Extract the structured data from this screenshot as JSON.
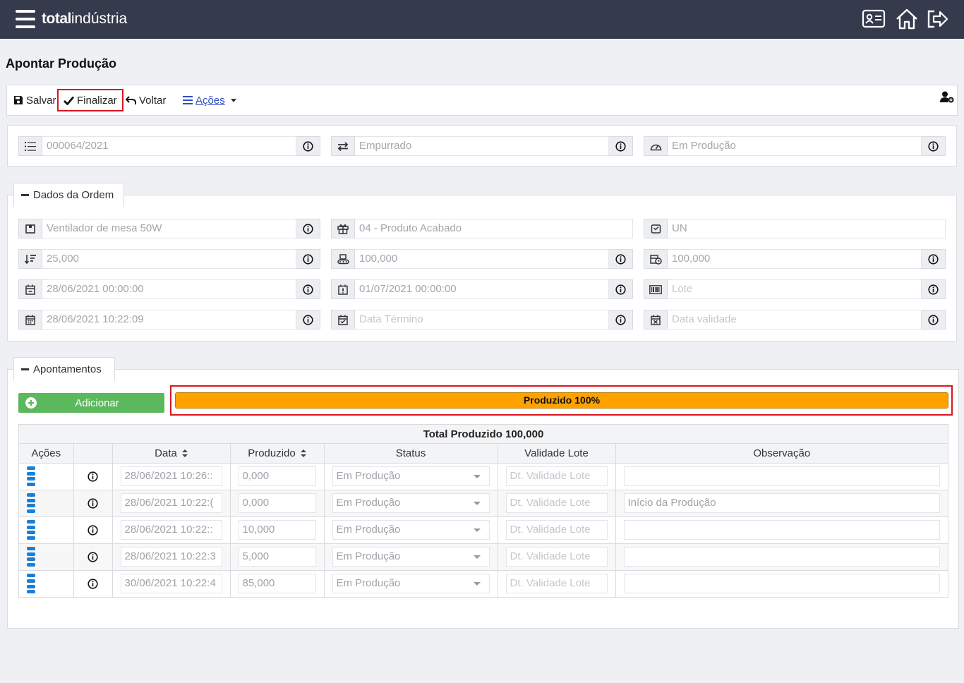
{
  "header": {
    "brand_bold": "total",
    "brand_light": "indústria"
  },
  "page_title": "Apontar Produção",
  "toolbar": {
    "save_label": "Salvar",
    "finalize_label": "Finalizar",
    "back_label": "Voltar",
    "actions_label": "Ações"
  },
  "top_fields": {
    "order_number": "000064/2021",
    "flow_type": "Empurrado",
    "status": "Em Produção"
  },
  "order_section": {
    "legend": "Dados da Ordem",
    "product": "Ventilador de mesa 50W",
    "product_type": "04 - Produto Acabado",
    "unit": "UN",
    "qty_1": "25,000",
    "qty_2": "100,000",
    "qty_3": "100,000",
    "date_1": "28/06/2021 00:00:00",
    "date_2": "01/07/2021 00:00:00",
    "lot_placeholder": "Lote",
    "start_date": "28/06/2021 10:22:09",
    "end_date_placeholder": "Data Término",
    "expiry_placeholder": "Data validade"
  },
  "appointments_section": {
    "legend": "Apontamentos",
    "add_button": "Adicionar",
    "progress_label": "Produzido 100%",
    "progress_value": 1.0,
    "total_label": "Total Produzido 100,000",
    "columns": [
      "Ações",
      "",
      "Data",
      "Produzido",
      "Status",
      "Validade Lote",
      "Observação"
    ],
    "rows": [
      {
        "date": "28/06/2021 10:26::",
        "produced": "0,000",
        "status": "Em Produção",
        "lot_expiry": "Dt. Validade Lote",
        "note": ""
      },
      {
        "date": "28/06/2021 10:22:(",
        "produced": "0,000",
        "status": "Em Produção",
        "lot_expiry": "Dt. Validade Lote",
        "note": "Início da Produção"
      },
      {
        "date": "28/06/2021 10:22::",
        "produced": "10,000",
        "status": "Em Produção",
        "lot_expiry": "Dt. Validade Lote",
        "note": ""
      },
      {
        "date": "28/06/2021 10:22:3",
        "produced": "5,000",
        "status": "Em Produção",
        "lot_expiry": "Dt. Validade Lote",
        "note": ""
      },
      {
        "date": "30/06/2021 10:22:4",
        "produced": "85,000",
        "status": "Em Produção",
        "lot_expiry": "Dt. Validade Lote",
        "note": ""
      }
    ]
  },
  "colors": {
    "topbar": "#353a4c",
    "progress": "#ffa200",
    "add_button": "#5cb85c",
    "highlight": "#d9161d",
    "row_menu": "#1a7fd8"
  }
}
